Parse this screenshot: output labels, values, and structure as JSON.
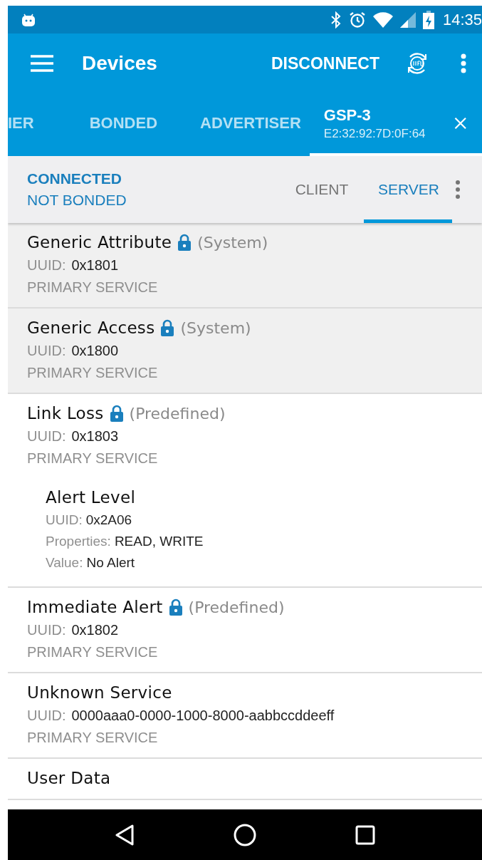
{
  "status_bar": {
    "time": "14:35"
  },
  "toolbar": {
    "title": "Devices",
    "action": "DISCONNECT"
  },
  "device_tabs": [
    {
      "label": "IER",
      "selected": false
    },
    {
      "label": "BONDED",
      "selected": false
    },
    {
      "label": "ADVERTISER",
      "selected": false
    },
    {
      "label": "GSP-3",
      "subtitle": "E2:32:92:7D:0F:64",
      "selected": true
    }
  ],
  "connection": {
    "state": "CONNECTED",
    "bond": "NOT BONDED"
  },
  "mode_tabs": [
    {
      "label": "CLIENT",
      "selected": false
    },
    {
      "label": "SERVER",
      "selected": true
    }
  ],
  "services": [
    {
      "name": "Generic Attribute",
      "locked": true,
      "tag": "(System)",
      "system": true,
      "uuid_label": "UUID:",
      "uuid": "0x1801",
      "type": "PRIMARY SERVICE"
    },
    {
      "name": "Generic Access",
      "locked": true,
      "tag": "(System)",
      "system": true,
      "uuid_label": "UUID:",
      "uuid": "0x1800",
      "type": "PRIMARY SERVICE"
    },
    {
      "name": "Link Loss",
      "locked": true,
      "tag": "(Predefined)",
      "system": false,
      "uuid_label": "UUID:",
      "uuid": "0x1803",
      "type": "PRIMARY SERVICE",
      "characteristics": [
        {
          "name": "Alert Level",
          "fields": [
            {
              "label": "UUID:",
              "value": "0x2A06"
            },
            {
              "label": "Properties:",
              "value": "READ, WRITE"
            },
            {
              "label": "Value:",
              "value": "No Alert"
            }
          ]
        }
      ]
    },
    {
      "name": "Immediate Alert",
      "locked": true,
      "tag": "(Predefined)",
      "system": false,
      "uuid_label": "UUID:",
      "uuid": "0x1802",
      "type": "PRIMARY SERVICE"
    },
    {
      "name": "Unknown Service",
      "locked": false,
      "system": false,
      "uuid_label": "UUID:",
      "uuid": "0000aaa0-0000-1000-8000-aabbccddeeff",
      "type": "PRIMARY SERVICE"
    },
    {
      "name": "User Data",
      "locked": false,
      "system": false
    }
  ]
}
